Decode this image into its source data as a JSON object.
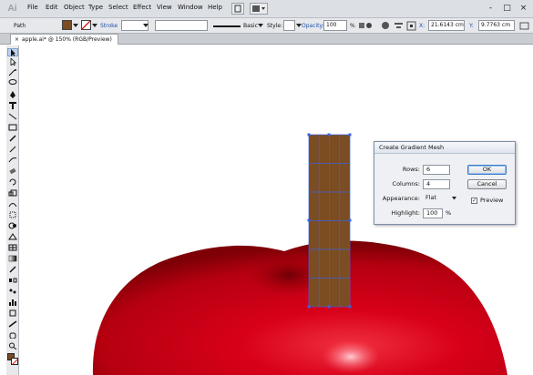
{
  "app": {
    "logo": "Ai"
  },
  "menubar": {
    "items": [
      "File",
      "Edit",
      "Object",
      "Type",
      "Select",
      "Effect",
      "View",
      "Window",
      "Help"
    ],
    "window_controls": [
      "-",
      "□",
      "×"
    ]
  },
  "controlbar": {
    "selection_type": "Path",
    "stroke_label": "Stroke",
    "brush_label": "Basic",
    "style_label": "Style:",
    "opacity_label": "Opacity:",
    "opacity_value": "100",
    "opacity_unit": "%",
    "x_label": "X:",
    "x_value": "21.6143 cm",
    "y_label": "Y:",
    "y_value": "9.7763 cm",
    "fill_color": "#7b4d22"
  },
  "document": {
    "tab_title": "apple.ai* @ 150% (RGB/Preview)",
    "close_glyph": "×"
  },
  "dialog": {
    "title": "Create Gradient Mesh",
    "rows_label": "Rows:",
    "rows_value": "6",
    "columns_label": "Columns:",
    "columns_value": "4",
    "appearance_label": "Appearance:",
    "appearance_value": "Flat",
    "highlight_label": "Highlight:",
    "highlight_value": "100",
    "highlight_unit": "%",
    "ok_label": "OK",
    "cancel_label": "Cancel",
    "preview_label": "Preview",
    "preview_checked": "✓"
  },
  "colors": {
    "apple_red": "#cc0010",
    "apple_dark": "#8a0008",
    "stem_brown": "#7b4d22",
    "mesh_blue": "#3a62e0"
  }
}
